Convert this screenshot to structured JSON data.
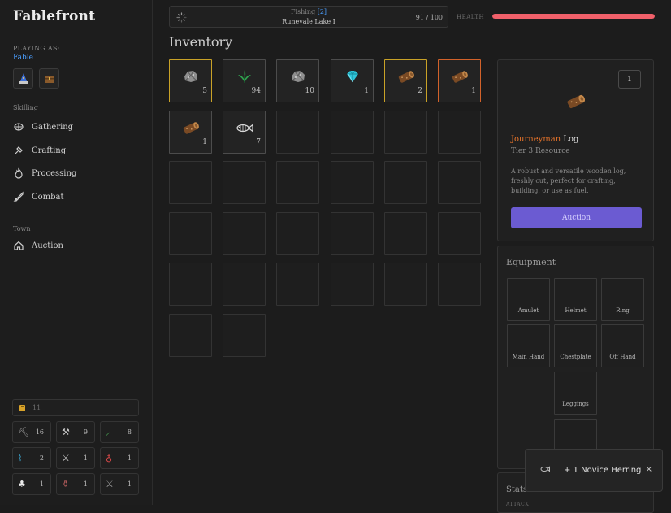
{
  "app": {
    "title": "Fablefront"
  },
  "player": {
    "label": "PLAYING AS:",
    "name": "Fable"
  },
  "nav": {
    "skilling_label": "Skilling",
    "skilling": [
      {
        "label": "Gathering",
        "icon": "gathering-icon"
      },
      {
        "label": "Crafting",
        "icon": "crafting-icon"
      },
      {
        "label": "Processing",
        "icon": "processing-icon"
      },
      {
        "label": "Combat",
        "icon": "combat-icon"
      }
    ],
    "town_label": "Town",
    "town": [
      {
        "label": "Auction",
        "icon": "auction-icon"
      }
    ]
  },
  "resources": {
    "gold": "11",
    "tools": [
      {
        "icon": "pickaxe-icon",
        "count": "16"
      },
      {
        "icon": "axe-icon",
        "count": "9"
      },
      {
        "icon": "sickle-icon",
        "count": "8"
      },
      {
        "icon": "fishing-rod-icon",
        "count": "2"
      },
      {
        "icon": "hammer-icon",
        "count": "1"
      },
      {
        "icon": "potion-icon",
        "count": "1"
      },
      {
        "icon": "chef-icon",
        "count": "1"
      },
      {
        "icon": "flask-icon",
        "count": "1"
      },
      {
        "icon": "sword-icon",
        "count": "1"
      }
    ]
  },
  "activity": {
    "skill": "Fishing",
    "level": "[2]",
    "location": "Runevale Lake I",
    "progress_text": "91 / 100"
  },
  "health": {
    "label": "HEALTH",
    "fraction": 1.0,
    "color": "#f0606a"
  },
  "inventory": {
    "title": "Inventory",
    "items": [
      {
        "icon": "stone-ore-icon",
        "qty": "5",
        "rarity": "gold"
      },
      {
        "icon": "herb-icon",
        "qty": "94",
        "rarity": "common"
      },
      {
        "icon": "stone-ore-icon",
        "qty": "10",
        "rarity": "common"
      },
      {
        "icon": "diamond-icon",
        "qty": "1",
        "rarity": "common"
      },
      {
        "icon": "log-icon",
        "qty": "2",
        "rarity": "gold"
      },
      {
        "icon": "log-icon",
        "qty": "1",
        "rarity": "orange"
      },
      {
        "icon": "log-icon",
        "qty": "1",
        "rarity": "common"
      },
      {
        "icon": "fish-icon",
        "qty": "7",
        "rarity": "common"
      }
    ],
    "total_slots": 32
  },
  "selected_item": {
    "count": "1",
    "icon": "log-icon",
    "tier_name": "Journeyman",
    "name": "Log",
    "subtitle": "Tier 3 Resource",
    "description": "A robust and versatile wooden log, freshly cut, perfect for crafting, building, or use as fuel.",
    "action": "Auction"
  },
  "equipment": {
    "title": "Equipment",
    "slots": [
      "Amulet",
      "Helmet",
      "Ring",
      "Main Hand",
      "Chestplate",
      "Off Hand",
      "Leggings",
      ""
    ]
  },
  "stats": {
    "title": "Stats",
    "first_row": "ATTACK"
  },
  "toast": {
    "icon": "fish-icon",
    "text": "+ 1 Novice Herring",
    "close": "×"
  },
  "colors": {
    "accent": "#6b5bd2",
    "gold_border": "#c9a227",
    "orange_border": "#d2622a",
    "link": "#4a9eff"
  }
}
